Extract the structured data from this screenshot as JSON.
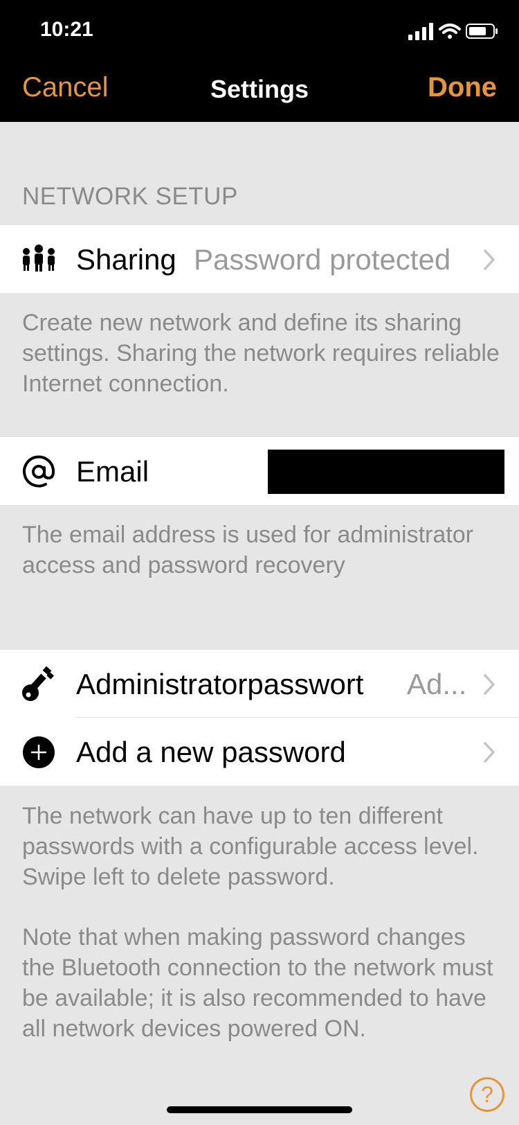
{
  "status_bar": {
    "time": "10:21"
  },
  "nav": {
    "cancel_label": "Cancel",
    "title": "Settings",
    "done_label": "Done"
  },
  "network_setup": {
    "header": "NETWORK SETUP",
    "sharing": {
      "label": "Sharing",
      "value": "Password protected"
    },
    "sharing_footer": "Create new network and define its sharing settings. Sharing the network requires reliable Internet connection."
  },
  "email": {
    "label": "Email",
    "footer": "The email address is used for administrator access and password recovery"
  },
  "passwords": {
    "admin": {
      "label": "Administratorpasswort",
      "value": "Ad..."
    },
    "add_new": {
      "label": "Add a new password"
    },
    "footer_1": "The network can have up to ten different passwords with a configurable access level. Swipe left to delete password.",
    "footer_2": "Note that when making password changes the Bluetooth connection to the network must be available; it is also recommended to have all network devices powered ON."
  },
  "help": {
    "label": "?"
  },
  "colors": {
    "accent": "#e6953a",
    "background": "#e6e6e6",
    "secondary_text": "#8a8a8a"
  }
}
